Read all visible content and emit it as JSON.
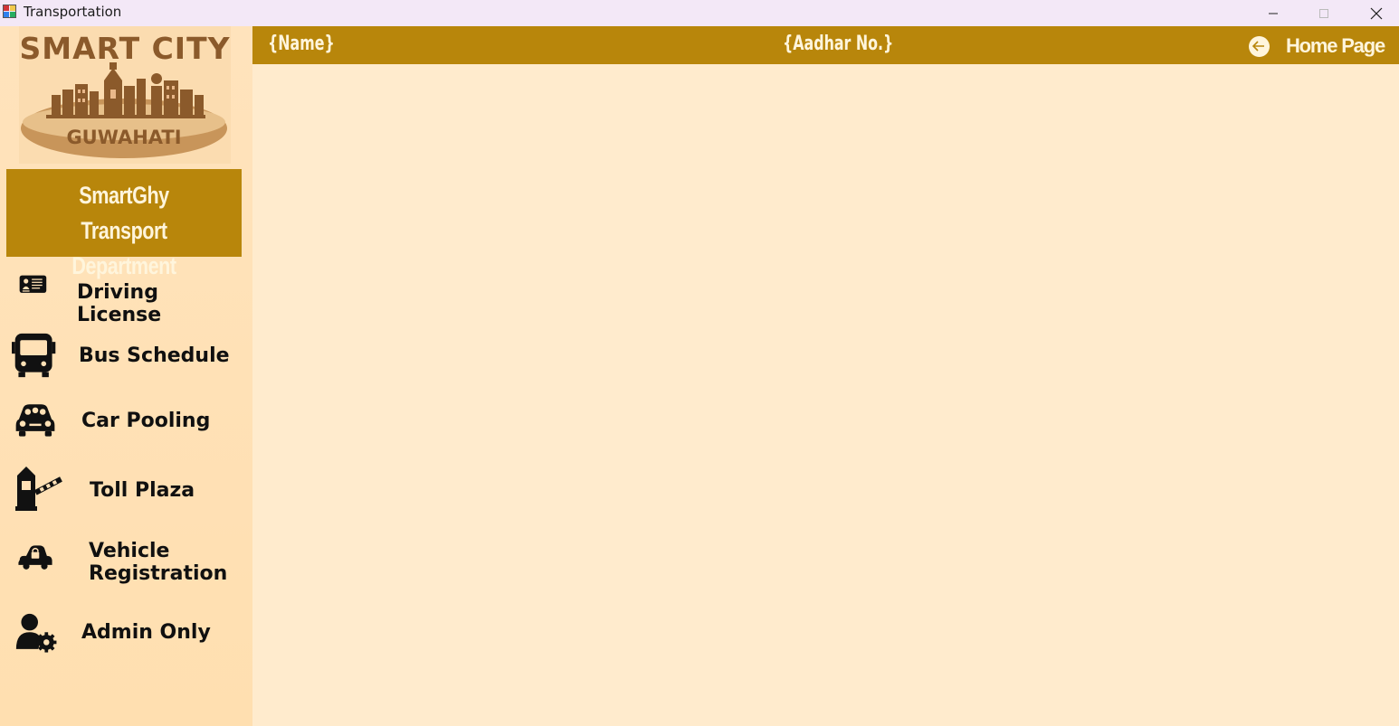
{
  "window": {
    "title": "Transportation",
    "controls": [
      "minimize",
      "maximize",
      "close"
    ]
  },
  "logo": {
    "line1": "SMART CITY",
    "line2": "GUWAHATI"
  },
  "department": {
    "line1": "SmartGhy",
    "line2": "Transport Department"
  },
  "nav": [
    {
      "label_lines": [
        "Driving License"
      ],
      "icon": "id-card-icon"
    },
    {
      "label_lines": [
        "Bus Schedule"
      ],
      "icon": "bus-icon"
    },
    {
      "label_lines": [
        "Car Pooling"
      ],
      "icon": "car-pool-icon"
    },
    {
      "label_lines": [
        "Toll Plaza"
      ],
      "icon": "toll-gate-icon"
    },
    {
      "label_lines": [
        "Vehicle",
        "Registration"
      ],
      "icon": "locked-car-icon"
    },
    {
      "label_lines": [
        "Admin Only"
      ],
      "icon": "admin-gear-icon"
    }
  ],
  "header": {
    "name": "{Name}",
    "aadhar": "{Aadhar No.}",
    "home_label": "Home Page"
  },
  "colors": {
    "accent": "#b8860b",
    "background": "#ffebcd",
    "accent_text": "#fff5dc"
  }
}
